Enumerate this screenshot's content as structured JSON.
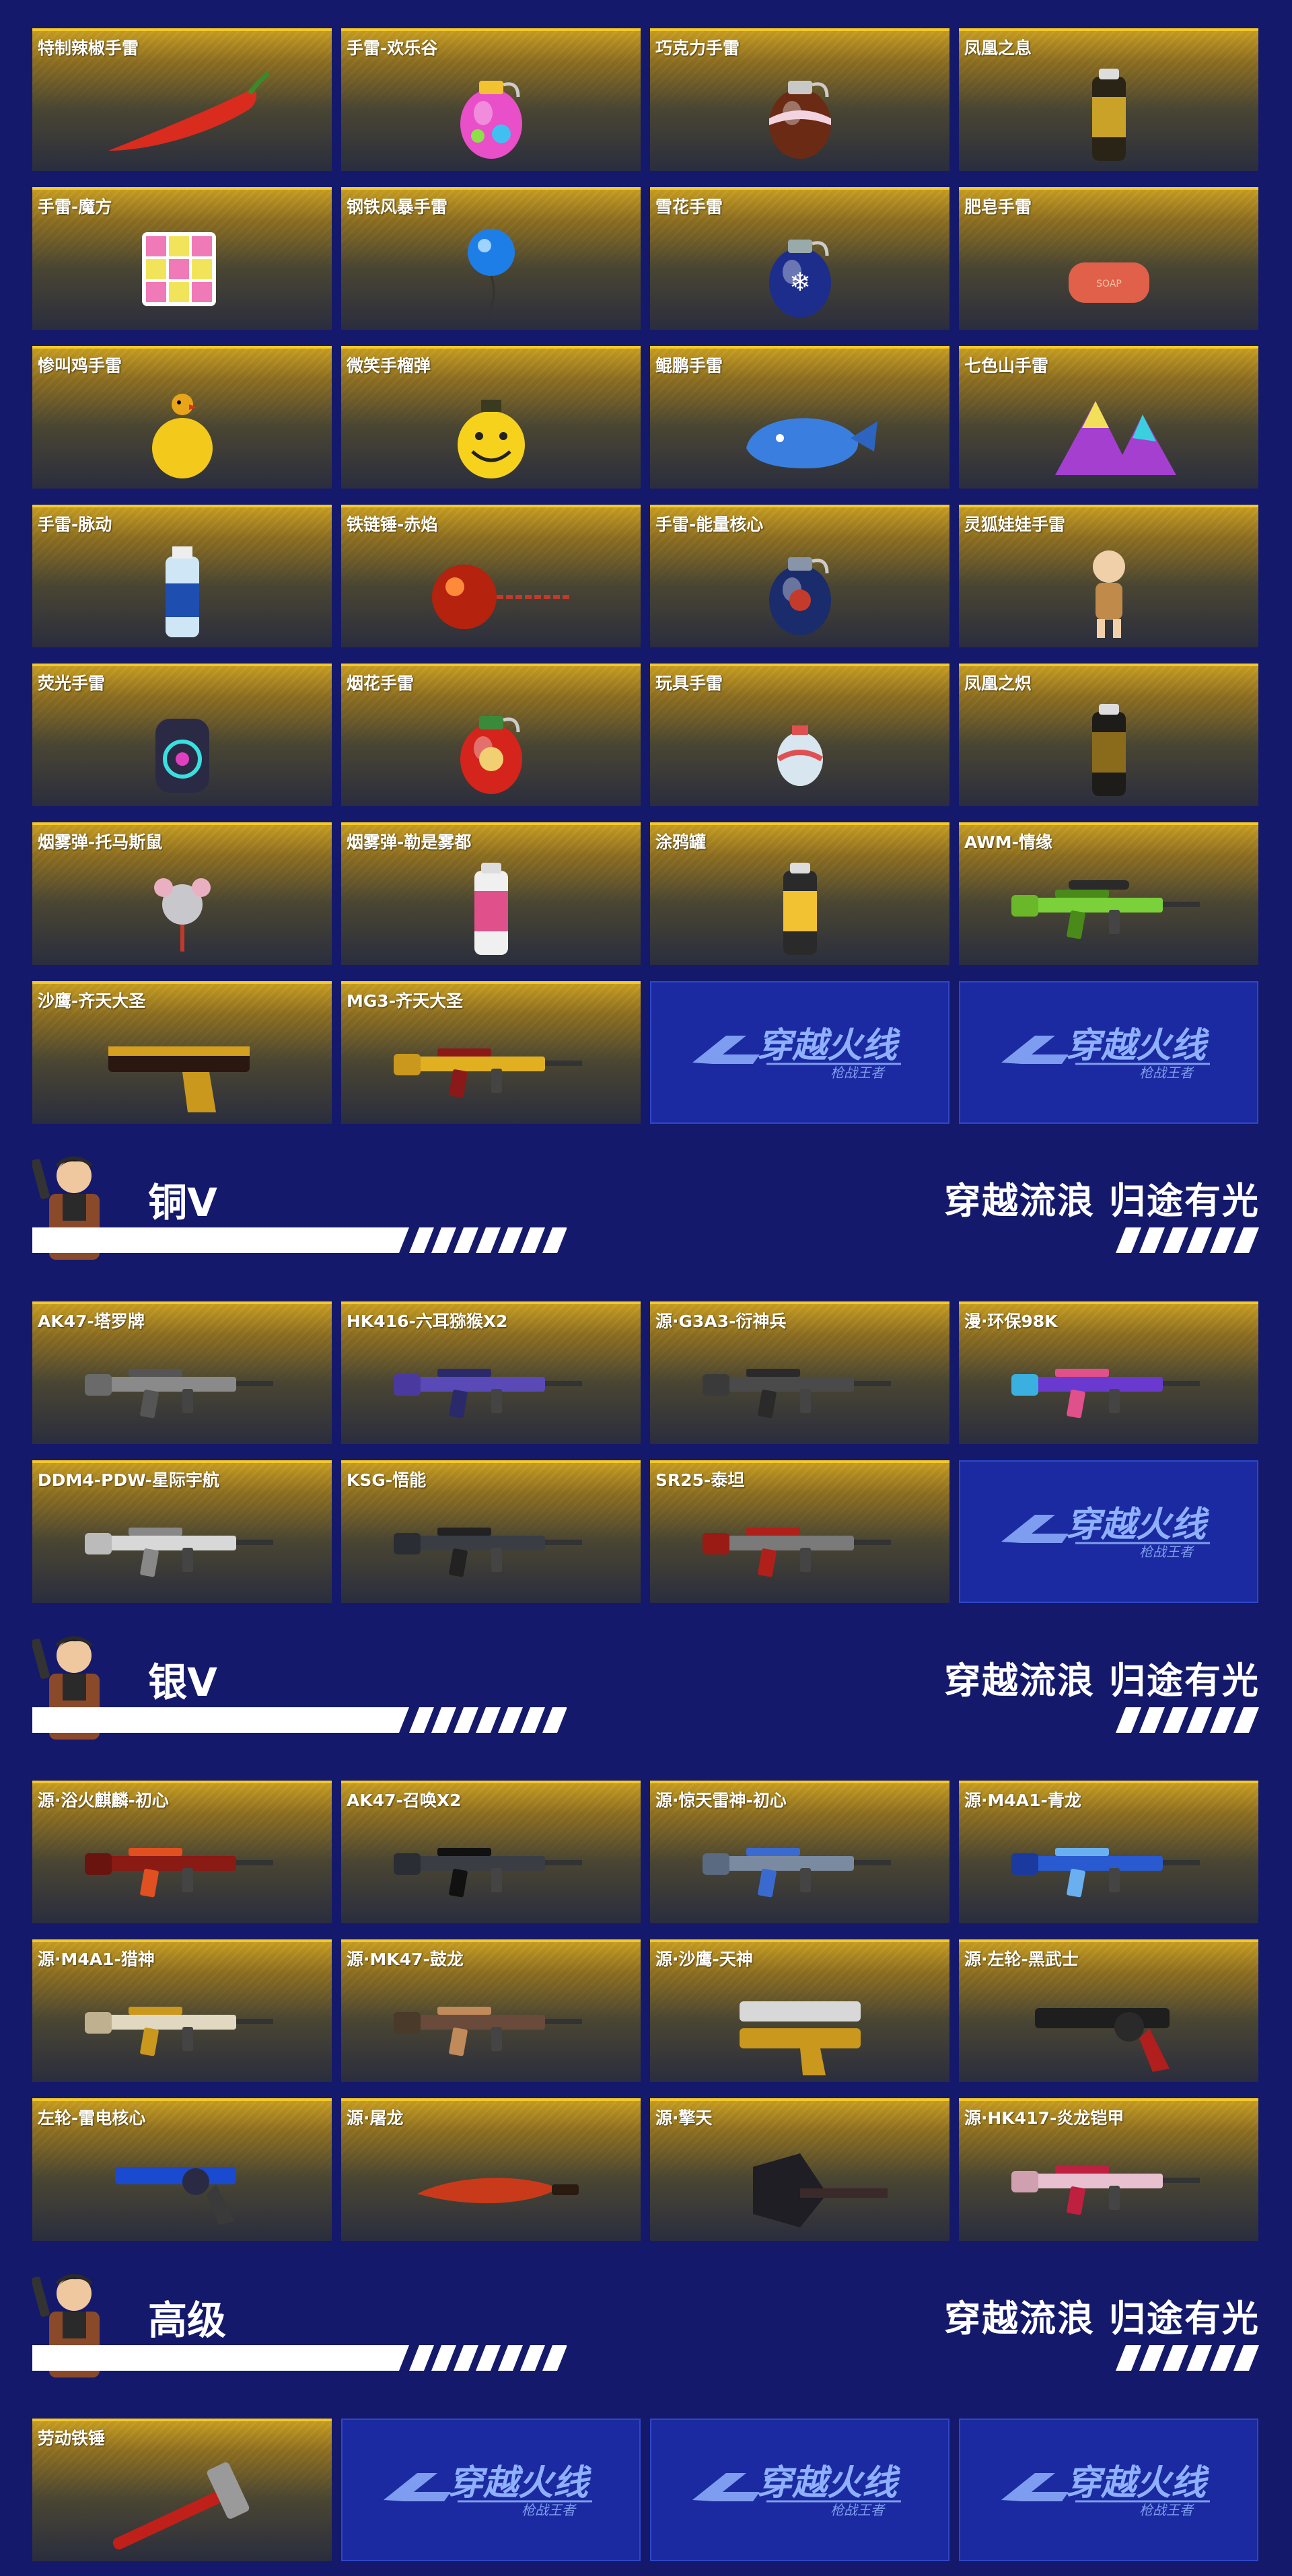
{
  "logo_text": "穿越火线",
  "logo_subtext": "枪战王者",
  "sections": [
    {
      "banner": null,
      "items": [
        {
          "name": "特制辣椒手雷",
          "icon": "chili-pepper"
        },
        {
          "name": "手雷-欢乐谷",
          "icon": "grenade-rainbow"
        },
        {
          "name": "巧克力手雷",
          "icon": "grenade-chocolate"
        },
        {
          "name": "凤凰之息",
          "icon": "canister-gold"
        },
        {
          "name": "手雷-魔方",
          "icon": "rubiks-cube"
        },
        {
          "name": "钢铁风暴手雷",
          "icon": "balloon-blue"
        },
        {
          "name": "雪花手雷",
          "icon": "grenade-snowflake"
        },
        {
          "name": "肥皂手雷",
          "icon": "soap-bar"
        },
        {
          "name": "惨叫鸡手雷",
          "icon": "chicken-ball"
        },
        {
          "name": "微笑手榴弹",
          "icon": "smiley-grenade"
        },
        {
          "name": "鲲鹏手雷",
          "icon": "blue-whale"
        },
        {
          "name": "七色山手雷",
          "icon": "rainbow-mountain"
        },
        {
          "name": "手雷-脉动",
          "icon": "drink-bottle"
        },
        {
          "name": "铁链锤-赤焰",
          "icon": "flame-flail"
        },
        {
          "name": "手雷-能量核心",
          "icon": "grenade-core"
        },
        {
          "name": "灵狐娃娃手雷",
          "icon": "fox-doll"
        },
        {
          "name": "荧光手雷",
          "icon": "neon-grenade"
        },
        {
          "name": "烟花手雷",
          "icon": "firework-grenade"
        },
        {
          "name": "玩具手雷",
          "icon": "toy-grenade"
        },
        {
          "name": "凤凰之炽",
          "icon": "canister-black"
        },
        {
          "name": "烟雾弹-托马斯鼠",
          "icon": "mouse-charm"
        },
        {
          "name": "烟雾弹-勒是雾都",
          "icon": "spray-can-pink"
        },
        {
          "name": "涂鸦罐",
          "icon": "spray-can-graffiti"
        },
        {
          "name": "AWM-情缘",
          "icon": "sniper-green"
        },
        {
          "name": "沙鹰-齐天大圣",
          "icon": "pistol-gold"
        },
        {
          "name": "MG3-齐天大圣",
          "icon": "machinegun-gold"
        }
      ],
      "logo_fillers": 2
    },
    {
      "banner": {
        "tier": "铜V",
        "slogan": "穿越流浪 归途有光"
      },
      "items": [
        {
          "name": "AK47-塔罗牌",
          "icon": "rifle-grey"
        },
        {
          "name": "HK416-六耳猕猴X2",
          "icon": "rifle-purple"
        },
        {
          "name": "源·G3A3-衍神兵",
          "icon": "rifle-dark"
        },
        {
          "name": "漫·环保98K",
          "icon": "rifle-graffiti"
        },
        {
          "name": "DDM4-PDW-星际宇航",
          "icon": "smg-white"
        },
        {
          "name": "KSG-悟能",
          "icon": "shotgun-dark"
        },
        {
          "name": "SR25-泰坦",
          "icon": "rifle-red"
        }
      ],
      "logo_fillers": 1
    },
    {
      "banner": {
        "tier": "银V",
        "slogan": "穿越流浪 归途有光"
      },
      "items": [
        {
          "name": "源·浴火麒麟-初心",
          "icon": "ak-red"
        },
        {
          "name": "AK47-召唤X2",
          "icon": "ak-dark"
        },
        {
          "name": "源·惊天雷神-初心",
          "icon": "rifle-thunder"
        },
        {
          "name": "源·M4A1-青龙",
          "icon": "rifle-blue-dragon"
        },
        {
          "name": "源·M4A1-猎神",
          "icon": "rifle-gold-white"
        },
        {
          "name": "源·MK47-鼓龙",
          "icon": "rifle-dragon-bronze"
        },
        {
          "name": "源·沙鹰-天神",
          "icon": "dual-pistol-gold"
        },
        {
          "name": "源·左轮-黑武士",
          "icon": "revolver-black"
        },
        {
          "name": "左轮-雷电核心",
          "icon": "revolver-blue"
        },
        {
          "name": "源·屠龙",
          "icon": "knife-red"
        },
        {
          "name": "源·擎天",
          "icon": "axe-black"
        },
        {
          "name": "源·HK417-炎龙铠甲",
          "icon": "rifle-pink"
        }
      ],
      "logo_fillers": 0
    },
    {
      "banner": {
        "tier": "高级",
        "slogan": "穿越流浪 归途有光"
      },
      "items": [
        {
          "name": "劳动铁锤",
          "icon": "hammer-red"
        }
      ],
      "logo_fillers": 3
    }
  ]
}
